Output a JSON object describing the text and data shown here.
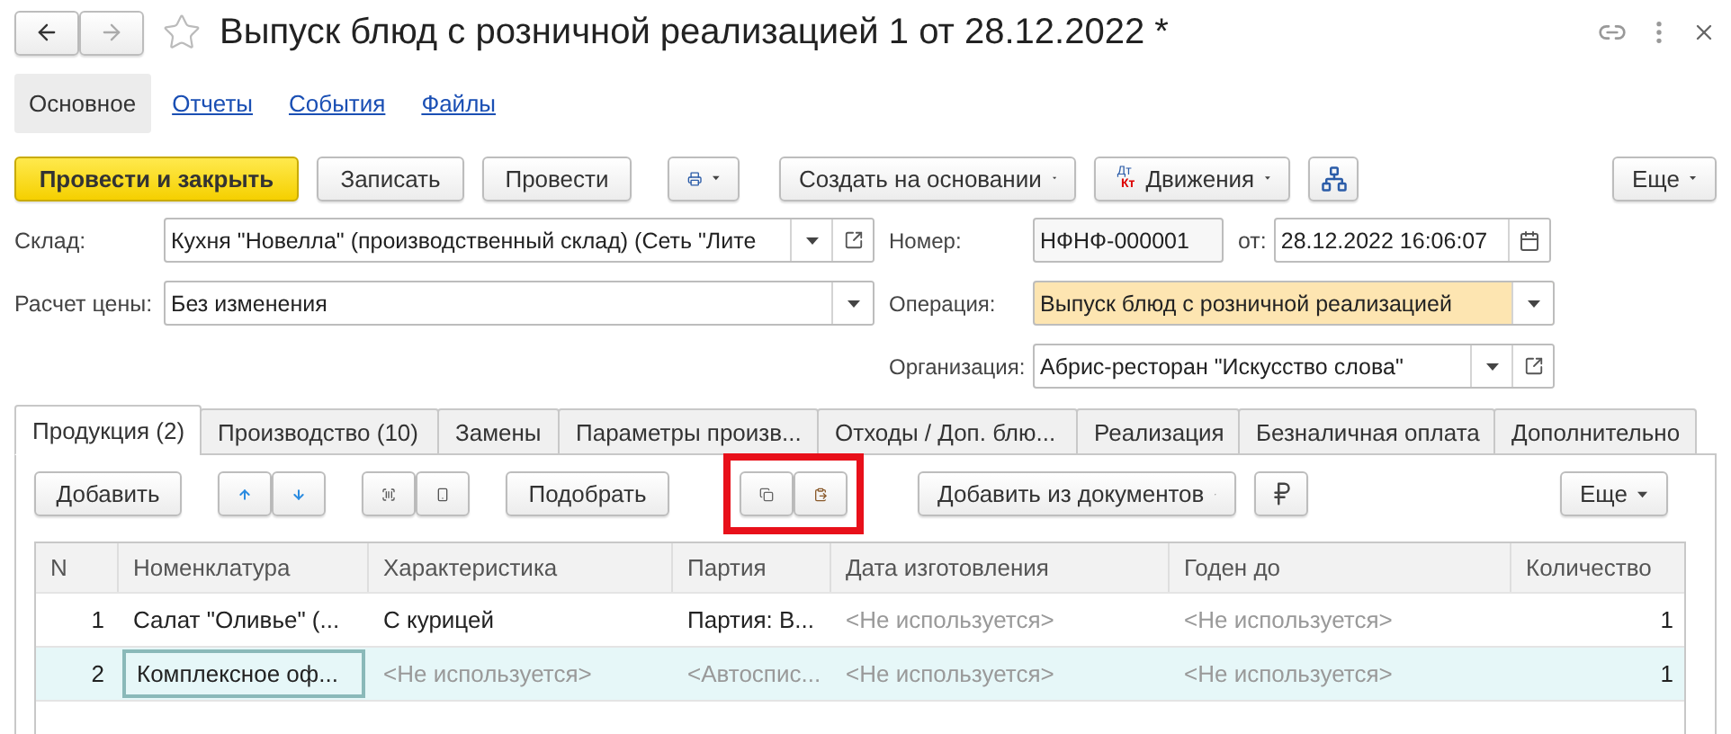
{
  "title": "Выпуск блюд с розничной реализацией 1 от 28.12.2022 *",
  "nav": [
    {
      "label": "Основное",
      "selected": true
    },
    {
      "label": "Отчеты",
      "selected": false
    },
    {
      "label": "События",
      "selected": false
    },
    {
      "label": "Файлы",
      "selected": false
    }
  ],
  "toolbar": {
    "primary": "Провести и закрыть",
    "buttons": [
      "Записать",
      "Провести"
    ],
    "create_based": "Создать на основании",
    "movements": "Движения",
    "movements_badge": [
      "Дт",
      "Кт"
    ],
    "more": "Еще"
  },
  "fields": {
    "warehouse": {
      "label": "Склад:",
      "value": "Кухня \"Новелла\" (производственный склад)  (Сеть \"Лите"
    },
    "price_calc": {
      "label": "Расчет цены:",
      "value": "Без изменения"
    },
    "number": {
      "label": "Номер:",
      "value": "НФНФ-000001"
    },
    "date": {
      "label": "от:",
      "value": "28.12.2022 16:06:07"
    },
    "operation": {
      "label": "Операция:",
      "value": "Выпуск блюд с розничной реализацией",
      "highlighted": true
    },
    "organization": {
      "label": "Организация:",
      "value": "Абрис-ресторан \"Искусство слова\""
    }
  },
  "tabs": [
    {
      "label": "Продукция (2)",
      "selected": true
    },
    {
      "label": "Производство (10)",
      "selected": false
    },
    {
      "label": "Замены",
      "selected": false
    },
    {
      "label": "Параметры произв...",
      "selected": false
    },
    {
      "label": "Отходы / Доп. блю...",
      "selected": false
    },
    {
      "label": "Реализация",
      "selected": false
    },
    {
      "label": "Безналичная оплата",
      "selected": false
    },
    {
      "label": "Дополнительно",
      "selected": false
    }
  ],
  "table_toolbar": {
    "add": "Добавить",
    "pick": "Подобрать",
    "add_from_docs": "Добавить из документов",
    "more": "Еще",
    "clipboard_highlighted": true
  },
  "table": {
    "columns": [
      "N",
      "Номенклатура",
      "Характеристика",
      "Партия",
      "Дата изготовления",
      "Годен до",
      "Количество"
    ],
    "rows": [
      {
        "selected": false,
        "cells": [
          {
            "text": "1",
            "muted": false
          },
          {
            "text": "Салат \"Оливье\" (...",
            "muted": false,
            "focused": false
          },
          {
            "text": "С курицей",
            "muted": false
          },
          {
            "text": "Партия: В...",
            "muted": false
          },
          {
            "text": "<Не используется>",
            "muted": true
          },
          {
            "text": "<Не используется>",
            "muted": true
          },
          {
            "text": "1",
            "muted": false
          }
        ]
      },
      {
        "selected": true,
        "cells": [
          {
            "text": "2",
            "muted": false
          },
          {
            "text": "Комплексное оф...",
            "muted": false,
            "focused": true
          },
          {
            "text": "<Не используется>",
            "muted": true
          },
          {
            "text": "<Автоспис...",
            "muted": true
          },
          {
            "text": "<Не используется>",
            "muted": true
          },
          {
            "text": "<Не используется>",
            "muted": true
          },
          {
            "text": "1",
            "muted": false
          }
        ]
      }
    ]
  }
}
